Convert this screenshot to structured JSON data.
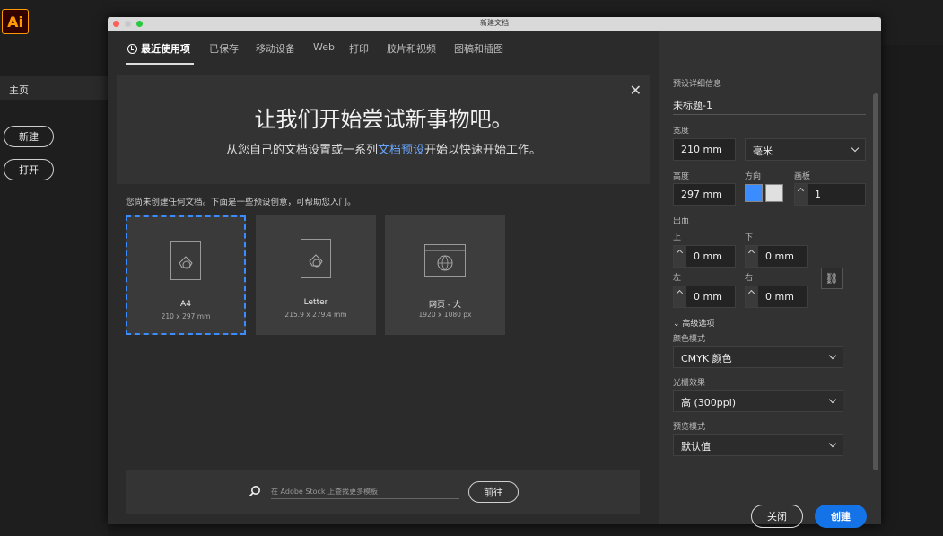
{
  "app": {
    "logo": "Ai",
    "home": "主页",
    "new_btn": "新建",
    "open_btn": "打开"
  },
  "dialog": {
    "title": "新建文档"
  },
  "tabs": [
    "最近使用项",
    "已保存",
    "移动设备",
    "Web",
    "打印",
    "胶片和视频",
    "图稿和插图"
  ],
  "hero": {
    "title": "让我们开始尝试新事物吧。",
    "sub_before": "从您自己的文档设置或一系列",
    "sub_link": "文档预设",
    "sub_after": "开始以快速开始工作。"
  },
  "hint": "您尚未创建任何文档。下面是一些预设创意，可帮助您入门。",
  "presets": [
    {
      "name": "A4",
      "size": "210 x 297 mm"
    },
    {
      "name": "Letter",
      "size": "215.9 x 279.4 mm"
    },
    {
      "name": "网页 - 大",
      "size": "1920 x 1080 px"
    }
  ],
  "search": {
    "placeholder": "在 Adobe Stock 上查找更多模板",
    "go": "前往"
  },
  "panel": {
    "header": "预设详细信息",
    "doc_name": "未标题-1",
    "width_label": "宽度",
    "width_value": "210 mm",
    "unit": "毫米",
    "height_label": "高度",
    "height_value": "297 mm",
    "orient_label": "方向",
    "artboard_label": "画板",
    "artboard_value": "1",
    "bleed_label": "出血",
    "top_label": "上",
    "bottom_label": "下",
    "left_label": "左",
    "right_label": "右",
    "bleed_top": "0 mm",
    "bleed_bottom": "0 mm",
    "bleed_left": "0 mm",
    "bleed_right": "0 mm",
    "advanced": "高级选项",
    "color_mode_label": "颜色模式",
    "color_mode": "CMYK 颜色",
    "raster_label": "光栅效果",
    "raster": "高 (300ppi)",
    "preview_label": "预览模式",
    "preview": "默认值",
    "close_btn": "关闭",
    "create_btn": "创建"
  }
}
